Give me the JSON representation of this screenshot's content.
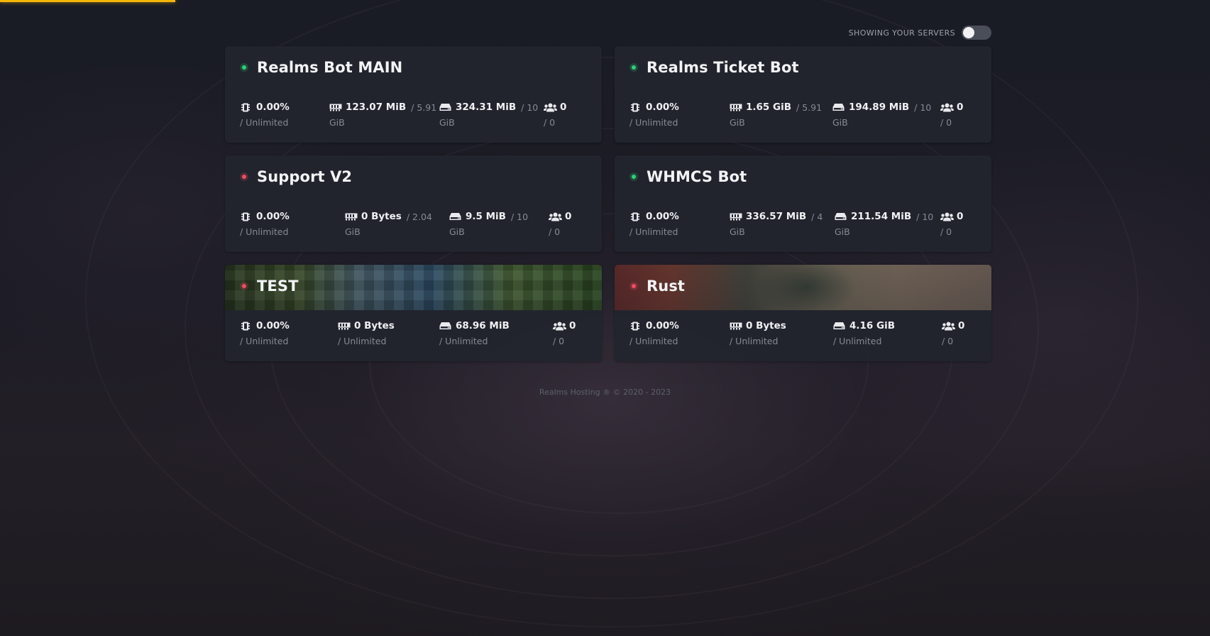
{
  "header": {
    "toggle_label": "SHOWING YOUR SERVERS",
    "toggle_on": false
  },
  "servers": [
    {
      "name": "Realms Bot MAIN",
      "status": "online",
      "banner": "",
      "cpu": {
        "value": "0.00%",
        "limit": "/ Unlimited"
      },
      "memory": {
        "value": "123.07 MiB",
        "limit_inline": "/ 5.91",
        "limit": "GiB"
      },
      "disk": {
        "value": "324.31 MiB",
        "limit_inline": "/ 10",
        "limit": "GiB"
      },
      "players": {
        "value": "0",
        "limit": "/ 0"
      }
    },
    {
      "name": "Realms Ticket Bot",
      "status": "online",
      "banner": "",
      "cpu": {
        "value": "0.00%",
        "limit": "/ Unlimited"
      },
      "memory": {
        "value": "1.65 GiB",
        "limit_inline": "/ 5.91",
        "limit": "GiB"
      },
      "disk": {
        "value": "194.89 MiB",
        "limit_inline": "/ 10",
        "limit": "GiB"
      },
      "players": {
        "value": "0",
        "limit": "/ 0"
      }
    },
    {
      "name": "Support V2",
      "status": "offline",
      "banner": "",
      "cpu": {
        "value": "0.00%",
        "limit": "/ Unlimited"
      },
      "memory": {
        "value": "0 Bytes",
        "limit_inline": "/ 2.04",
        "limit": "GiB"
      },
      "disk": {
        "value": "9.5 MiB",
        "limit_inline": "/ 10",
        "limit": "GiB"
      },
      "players": {
        "value": "0",
        "limit": "/ 0"
      }
    },
    {
      "name": "WHMCS Bot",
      "status": "online",
      "banner": "",
      "cpu": {
        "value": "0.00%",
        "limit": "/ Unlimited"
      },
      "memory": {
        "value": "336.57 MiB",
        "limit_inline": "/ 4",
        "limit": "GiB"
      },
      "disk": {
        "value": "211.54 MiB",
        "limit_inline": "/ 10",
        "limit": "GiB"
      },
      "players": {
        "value": "0",
        "limit": "/ 0"
      }
    },
    {
      "name": "TEST",
      "status": "offline",
      "banner": "minecraft",
      "cpu": {
        "value": "0.00%",
        "limit": "/ Unlimited"
      },
      "memory": {
        "value": "0 Bytes",
        "limit_inline": "",
        "limit": "/ Unlimited"
      },
      "disk": {
        "value": "68.96 MiB",
        "limit_inline": "",
        "limit": "/ Unlimited"
      },
      "players": {
        "value": "0",
        "limit": "/ 0"
      }
    },
    {
      "name": "Rust",
      "status": "offline",
      "banner": "rust",
      "cpu": {
        "value": "0.00%",
        "limit": "/ Unlimited"
      },
      "memory": {
        "value": "0 Bytes",
        "limit_inline": "",
        "limit": "/ Unlimited"
      },
      "disk": {
        "value": "4.16 GiB",
        "limit_inline": "",
        "limit": "/ Unlimited"
      },
      "players": {
        "value": "0",
        "limit": "/ 0"
      }
    }
  ],
  "icons": {
    "cpu": "cpu-icon",
    "memory": "memory-icon",
    "disk": "disk-icon",
    "players": "users-icon"
  },
  "colors": {
    "accent": "#f5b60a",
    "online": "#2fd07a",
    "offline": "#ee4d64"
  },
  "footer": {
    "text": "Realms Hosting ® © 2020 - 2023"
  }
}
